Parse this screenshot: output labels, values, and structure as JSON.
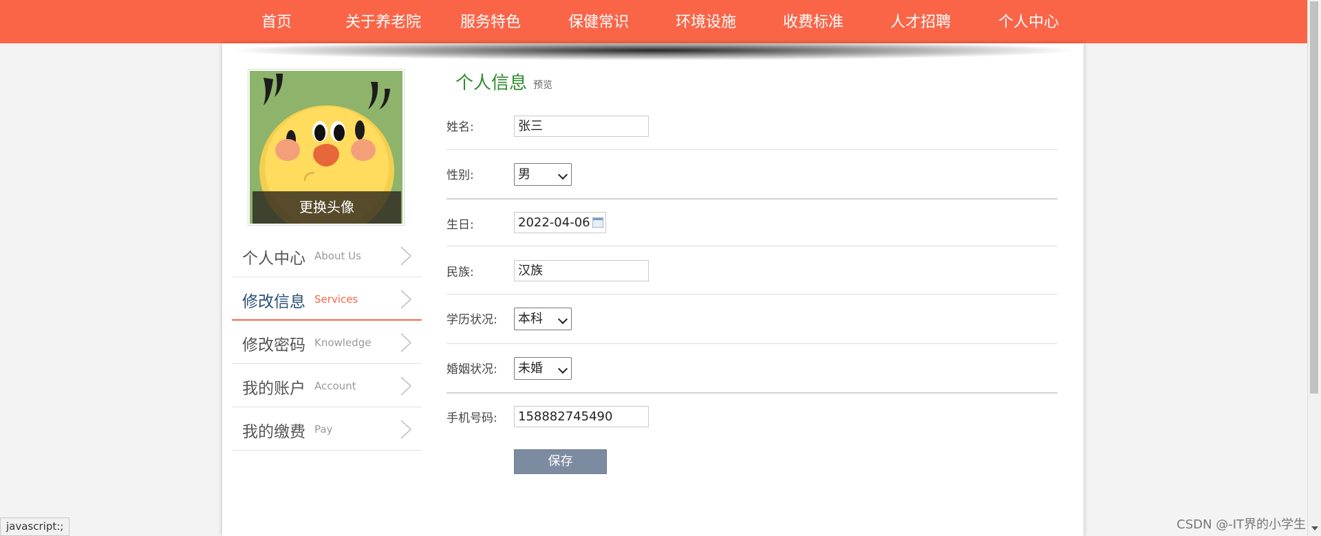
{
  "nav": {
    "items": [
      {
        "label": "首页"
      },
      {
        "label": "关于养老院"
      },
      {
        "label": "服务特色"
      },
      {
        "label": "保健常识"
      },
      {
        "label": "环境设施"
      },
      {
        "label": "收费标准"
      },
      {
        "label": "人才招聘"
      },
      {
        "label": "个人中心"
      }
    ]
  },
  "avatar": {
    "change_label": "更换头像"
  },
  "sidemenu": {
    "items": [
      {
        "cn": "个人中心",
        "en": "About Us",
        "active": false
      },
      {
        "cn": "修改信息",
        "en": "Services",
        "active": true
      },
      {
        "cn": "修改密码",
        "en": "Knowledge",
        "active": false
      },
      {
        "cn": "我的账户",
        "en": "Account",
        "active": false
      },
      {
        "cn": "我的缴费",
        "en": "Pay",
        "active": false
      }
    ]
  },
  "profile": {
    "title": "个人信息",
    "subtitle": "预览",
    "fields": {
      "name": {
        "label": "姓名:",
        "value": "张三"
      },
      "gender": {
        "label": "性别:",
        "value": "男"
      },
      "birthday": {
        "label": "生日:",
        "value": "2022-04-06"
      },
      "ethnicity": {
        "label": "民族:",
        "value": "汉族"
      },
      "education": {
        "label": "学历状况:",
        "value": "本科"
      },
      "marital": {
        "label": "婚姻状况:",
        "value": "未婚"
      },
      "phone": {
        "label": "手机号码:",
        "value": "158882745490"
      }
    },
    "save_label": "保存"
  },
  "statusbar": {
    "text": "javascript:;"
  },
  "watermark": {
    "text": "CSDN @-IT界的小学生"
  },
  "colors": {
    "accent": "#fa6548",
    "title_green": "#2e8b2e",
    "button": "#7c8ba0"
  }
}
